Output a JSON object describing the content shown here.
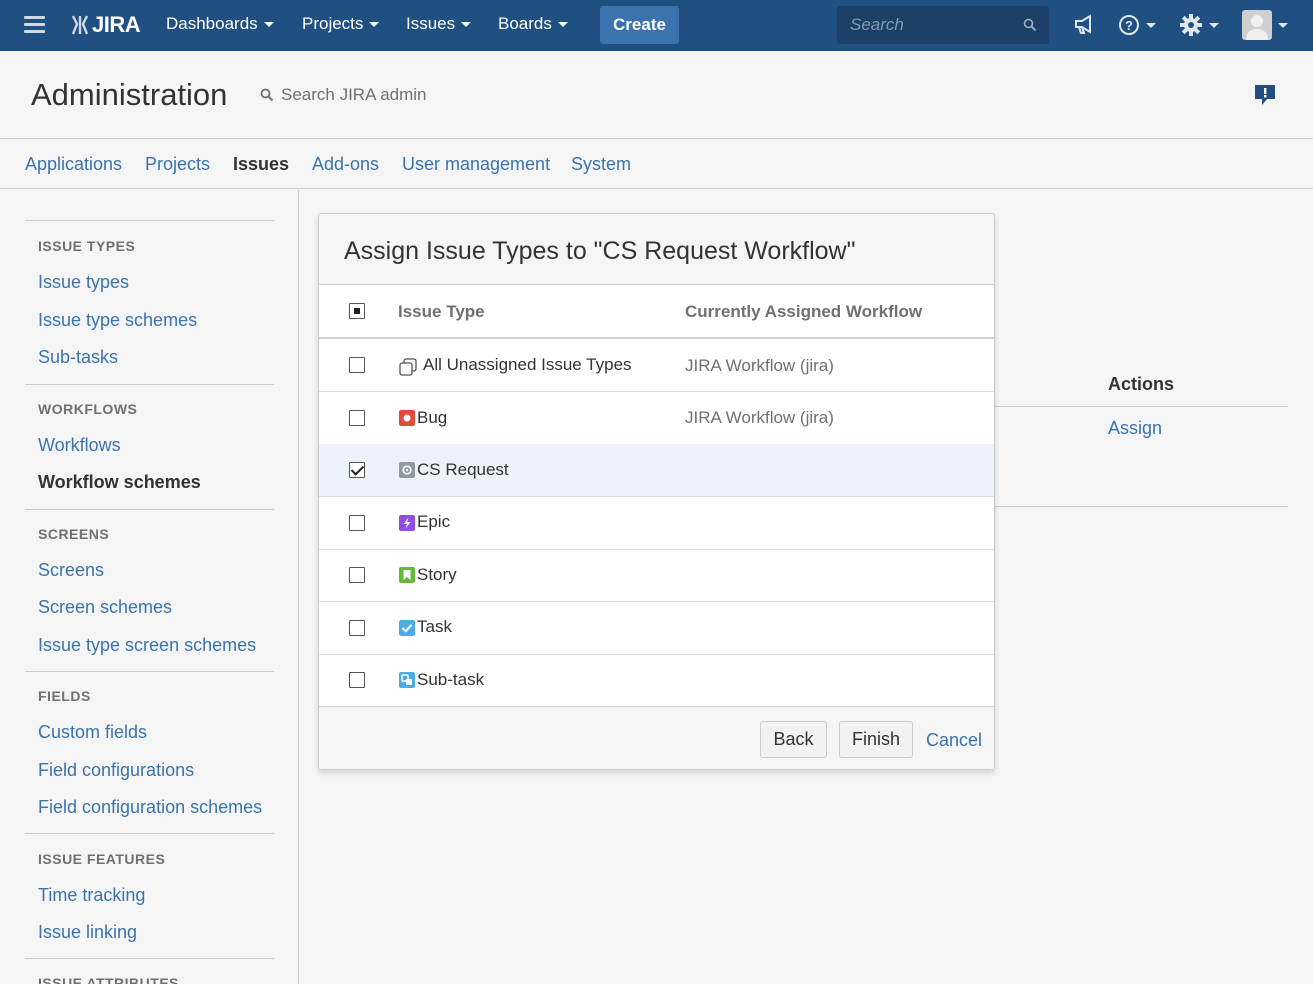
{
  "topnav": {
    "logo_text": "JIRA",
    "items": [
      {
        "label": "Dashboards"
      },
      {
        "label": "Projects"
      },
      {
        "label": "Issues"
      },
      {
        "label": "Boards"
      }
    ],
    "create_label": "Create",
    "search_placeholder": "Search"
  },
  "admin": {
    "title": "Administration",
    "search_label": "Search JIRA admin"
  },
  "tabs": [
    {
      "label": "Applications"
    },
    {
      "label": "Projects"
    },
    {
      "label": "Issues",
      "active": true
    },
    {
      "label": "Add-ons"
    },
    {
      "label": "User management"
    },
    {
      "label": "System"
    }
  ],
  "sidebar": {
    "sections": [
      {
        "heading": "ISSUE TYPES",
        "links": [
          "Issue types",
          "Issue type schemes",
          "Sub-tasks"
        ]
      },
      {
        "heading": "WORKFLOWS",
        "links": [
          "Workflows",
          "Workflow schemes"
        ]
      },
      {
        "heading": "SCREENS",
        "links": [
          "Screens",
          "Screen schemes",
          "Issue type screen schemes"
        ]
      },
      {
        "heading": "FIELDS",
        "links": [
          "Custom fields",
          "Field configurations",
          "Field configuration schemes"
        ]
      },
      {
        "heading": "ISSUE FEATURES",
        "links": [
          "Time tracking",
          "Issue linking"
        ]
      },
      {
        "heading": "ISSUE ATTRIBUTES",
        "links": []
      }
    ],
    "active_link": "Workflow schemes"
  },
  "background": {
    "actions_header": "Actions",
    "assign_link": "Assign"
  },
  "dialog": {
    "title": "Assign Issue Types to \"CS Request Workflow\"",
    "col_issue_type": "Issue Type",
    "col_workflow": "Currently Assigned Workflow",
    "rows": [
      {
        "name": "All Unassigned Issue Types",
        "workflow": "JIRA Workflow (jira)",
        "checked": false,
        "icon": "unassigned-icon"
      },
      {
        "name": "Bug",
        "workflow": "JIRA Workflow (jira)",
        "checked": false,
        "icon": "bug-icon",
        "color": "#e5493a"
      },
      {
        "name": "CS Request",
        "workflow": "",
        "checked": true,
        "icon": "cs-request-icon",
        "color": "#8f9aa5"
      },
      {
        "name": "Epic",
        "workflow": "",
        "checked": false,
        "icon": "epic-icon",
        "color": "#904ee2"
      },
      {
        "name": "Story",
        "workflow": "",
        "checked": false,
        "icon": "story-icon",
        "color": "#63ba3c"
      },
      {
        "name": "Task",
        "workflow": "",
        "checked": false,
        "icon": "task-icon",
        "color": "#4bade8"
      },
      {
        "name": "Sub-task",
        "workflow": "",
        "checked": false,
        "icon": "subtask-icon",
        "color": "#4bade8"
      }
    ],
    "back_label": "Back",
    "finish_label": "Finish",
    "cancel_label": "Cancel"
  },
  "colors": {
    "nav_bg": "#205081",
    "link": "#3b73af",
    "create_btn": "#3b73af"
  }
}
